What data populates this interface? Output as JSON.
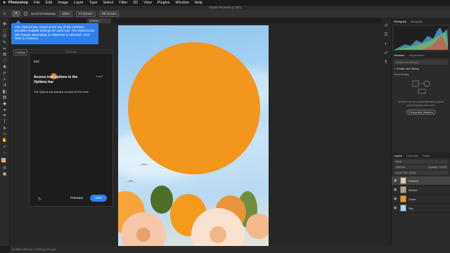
{
  "menubar": {
    "app": "Photoshop",
    "items": [
      "File",
      "Edit",
      "Image",
      "Layer",
      "Type",
      "Select",
      "Filter",
      "3D",
      "View",
      "Plugins",
      "Window",
      "Help"
    ]
  },
  "window_title": "Adobe Photoshop 2021",
  "options": {
    "scroll_all": "Scroll All Windows",
    "zoom": "100%",
    "fit_screen": "Fit Screen",
    "fill_screen": "Fill Screen"
  },
  "doc_tab": "RGB/8) *",
  "tooltip_text": "The Options bar, found at the top of the interface, provides multiple settings for each tool. The Options bar will change depending on what tool is selected. Click Next to continue",
  "context_label": "Contact",
  "discover": {
    "header": "Discover",
    "exit": "Exit",
    "heading": "Access tool options in the Options bar",
    "step": "3 of 3",
    "body": "The Options bar contains controls for the tools.",
    "previous": "Previous",
    "next": "Next"
  },
  "panels": {
    "histogram_tab": "Histogram",
    "navigator_tab": "Navigator",
    "libraries_tab": "Libraries",
    "adjustments_tab": "Adjustments",
    "search_placeholder": "Search all libraries",
    "create_library": "+ Create new library",
    "your_library": "Your Library",
    "library_desc": "Choose from pre-made libraries to speed up and inspire your work.",
    "find_libraries": "Find public libraries",
    "layers_tab": "Layers",
    "channels_tab": "Channels",
    "paths_tab": "Paths",
    "kind_label": "Kind",
    "blend_mode": "Normal",
    "opacity": "Opacity: 100%",
    "lock_fill": "Lock:  Fill: 100%",
    "layers": [
      {
        "name": "Flowers",
        "selected": true,
        "thumb": "#e6c9a4"
      },
      {
        "name": "Worker",
        "selected": false,
        "thumb": "#b1a18f"
      },
      {
        "name": "Circle",
        "selected": false,
        "thumb": "#f2961c"
      },
      {
        "name": "Sky",
        "selected": false,
        "thumb": "#a9d4f3"
      }
    ]
  },
  "status": "50.68%   1920 px x 1920 px (72 ppi)"
}
